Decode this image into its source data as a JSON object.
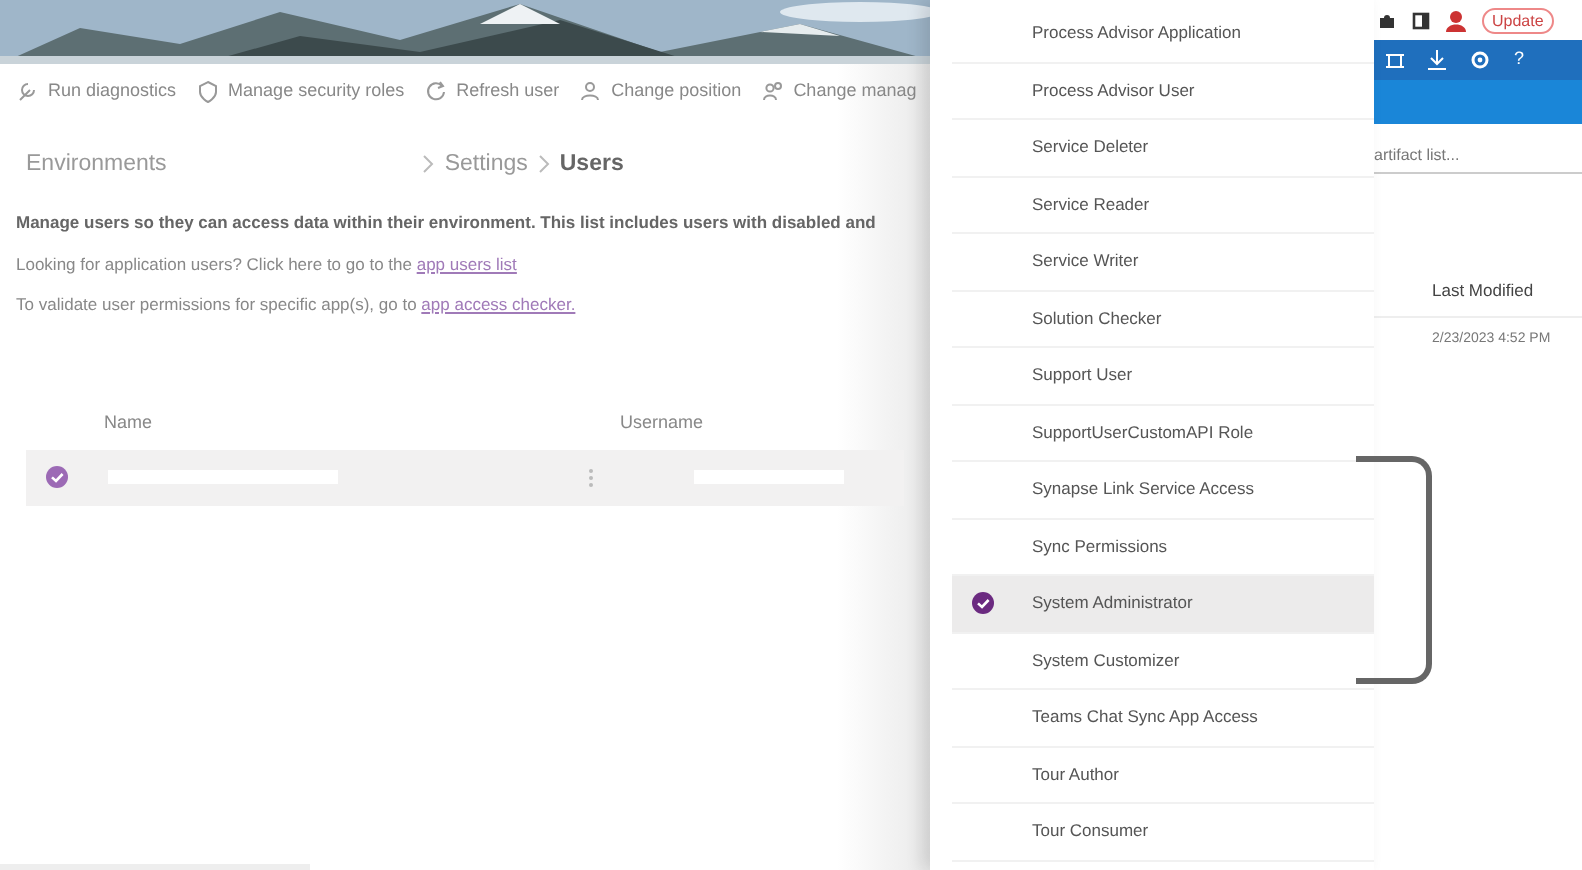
{
  "toolbar": [
    {
      "label": "Run diagnostics"
    },
    {
      "label": "Manage security roles"
    },
    {
      "label": "Refresh user"
    },
    {
      "label": "Change position"
    },
    {
      "label": "Change manag"
    }
  ],
  "breadcrumb": [
    {
      "label": "Environments",
      "current": false
    },
    {
      "label": "Settings",
      "current": false
    },
    {
      "label": "Users",
      "current": true
    }
  ],
  "description": {
    "intro": "Manage users so they can access data within their environment. This list includes users with disabled and",
    "lines": [
      {
        "text": "Looking for application users? Click here to go to the",
        "link": "app users list"
      },
      {
        "text": "To validate user permissions for specific app(s), go to",
        "link": "app access checker."
      }
    ]
  },
  "users_table": {
    "columns": [
      "Name",
      "Username"
    ],
    "rows": [
      {
        "selected": true
      }
    ]
  },
  "roles_panel": {
    "items": [
      {
        "label": "Process Advisor Application",
        "selected": false
      },
      {
        "label": "Process Advisor User",
        "selected": false
      },
      {
        "label": "Service Deleter",
        "selected": false
      },
      {
        "label": "Service Reader",
        "selected": false
      },
      {
        "label": "Service Writer",
        "selected": false
      },
      {
        "label": "Solution Checker",
        "selected": false
      },
      {
        "label": "Support User",
        "selected": false
      },
      {
        "label": "SupportUserCustomAPI Role",
        "selected": false
      },
      {
        "label": "Synapse Link Service Access",
        "selected": false
      },
      {
        "label": "Sync Permissions",
        "selected": false
      },
      {
        "label": "System Administrator",
        "selected": true
      },
      {
        "label": "System Customizer",
        "selected": false
      },
      {
        "label": "Teams Chat Sync App Access",
        "selected": false
      },
      {
        "label": "Tour Author",
        "selected": false
      },
      {
        "label": "Tour Consumer",
        "selected": false
      }
    ]
  },
  "background_app": {
    "update_button": "Update",
    "help_icon": "?",
    "search_text": "artifact list...",
    "column": "Last Modified",
    "cell": "2/23/2023 4:52 PM"
  }
}
